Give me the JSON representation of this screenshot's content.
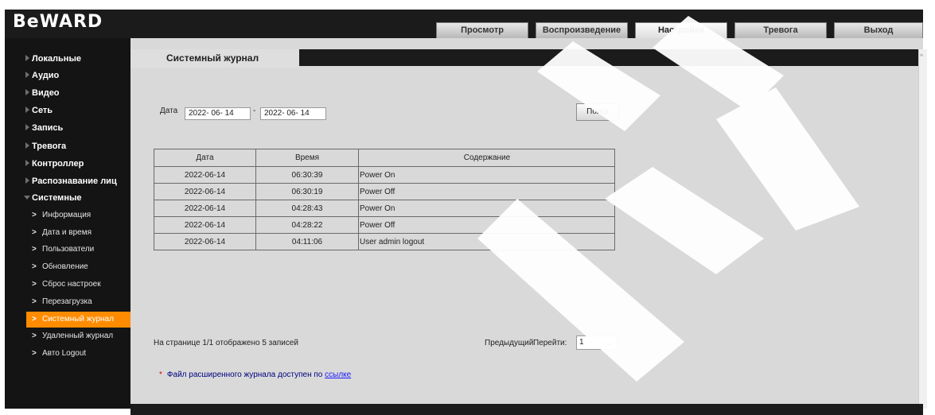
{
  "brand": {
    "logo_text": "BeWARD"
  },
  "top_nav": {
    "tabs": [
      {
        "label": "Просмотр",
        "active": false
      },
      {
        "label": "Воспроизведение",
        "active": false
      },
      {
        "label": "Настройки",
        "active": true
      },
      {
        "label": "Тревога",
        "active": false
      },
      {
        "label": "Выход",
        "active": false
      }
    ]
  },
  "sidebar": {
    "items": [
      {
        "label": "Локальные",
        "expanded": false
      },
      {
        "label": "Аудио",
        "expanded": false
      },
      {
        "label": "Видео",
        "expanded": false
      },
      {
        "label": "Сеть",
        "expanded": false
      },
      {
        "label": "Запись",
        "expanded": false
      },
      {
        "label": "Тревога",
        "expanded": false
      },
      {
        "label": "Контроллер",
        "expanded": false
      },
      {
        "label": "Распознавание лиц",
        "expanded": false
      },
      {
        "label": "Системные",
        "expanded": true
      }
    ],
    "sub_items": [
      {
        "label": "Информация",
        "active": false
      },
      {
        "label": "Дата и время",
        "active": false
      },
      {
        "label": "Пользователи",
        "active": false
      },
      {
        "label": "Обновление",
        "active": false
      },
      {
        "label": "Сброс настроек",
        "active": false
      },
      {
        "label": "Перезагрузка",
        "active": false
      },
      {
        "label": "Системный журнал",
        "active": true
      },
      {
        "label": "Удаленный журнал",
        "active": false
      },
      {
        "label": "Авто Logout",
        "active": false
      }
    ],
    "arrow_glyph": ">"
  },
  "page": {
    "title": "Системный журнал",
    "date_label": "Дата",
    "date_from": "2022- 06- 14",
    "date_to": "2022- 06- 14",
    "date_separator": "-",
    "search_button": "Поиск",
    "table": {
      "columns": [
        "Дата",
        "Время",
        "Содержание"
      ],
      "rows": [
        [
          "2022-06-14",
          "06:30:39",
          "Power On"
        ],
        [
          "2022-06-14",
          "06:30:19",
          "Power Off"
        ],
        [
          "2022-06-14",
          "04:28:43",
          "Power On"
        ],
        [
          "2022-06-14",
          "04:28:22",
          "Power Off"
        ],
        [
          "2022-06-14",
          "04:11:06",
          "User admin logout"
        ]
      ]
    },
    "page_info": "На странице 1/1 отображено 5 записей",
    "prev_label": "Предыдущий",
    "goto_label": "Перейти:",
    "page_select_value": "1",
    "note_star": "*",
    "note_text": "Файл расширенного журнала доступен по",
    "note_link": "ссылке"
  },
  "colors": {
    "header_bg": "#1b1b1b",
    "content_bg": "#d9d9d9",
    "active_sub_item": "#ff8c00",
    "watermark": "#ffffff"
  }
}
